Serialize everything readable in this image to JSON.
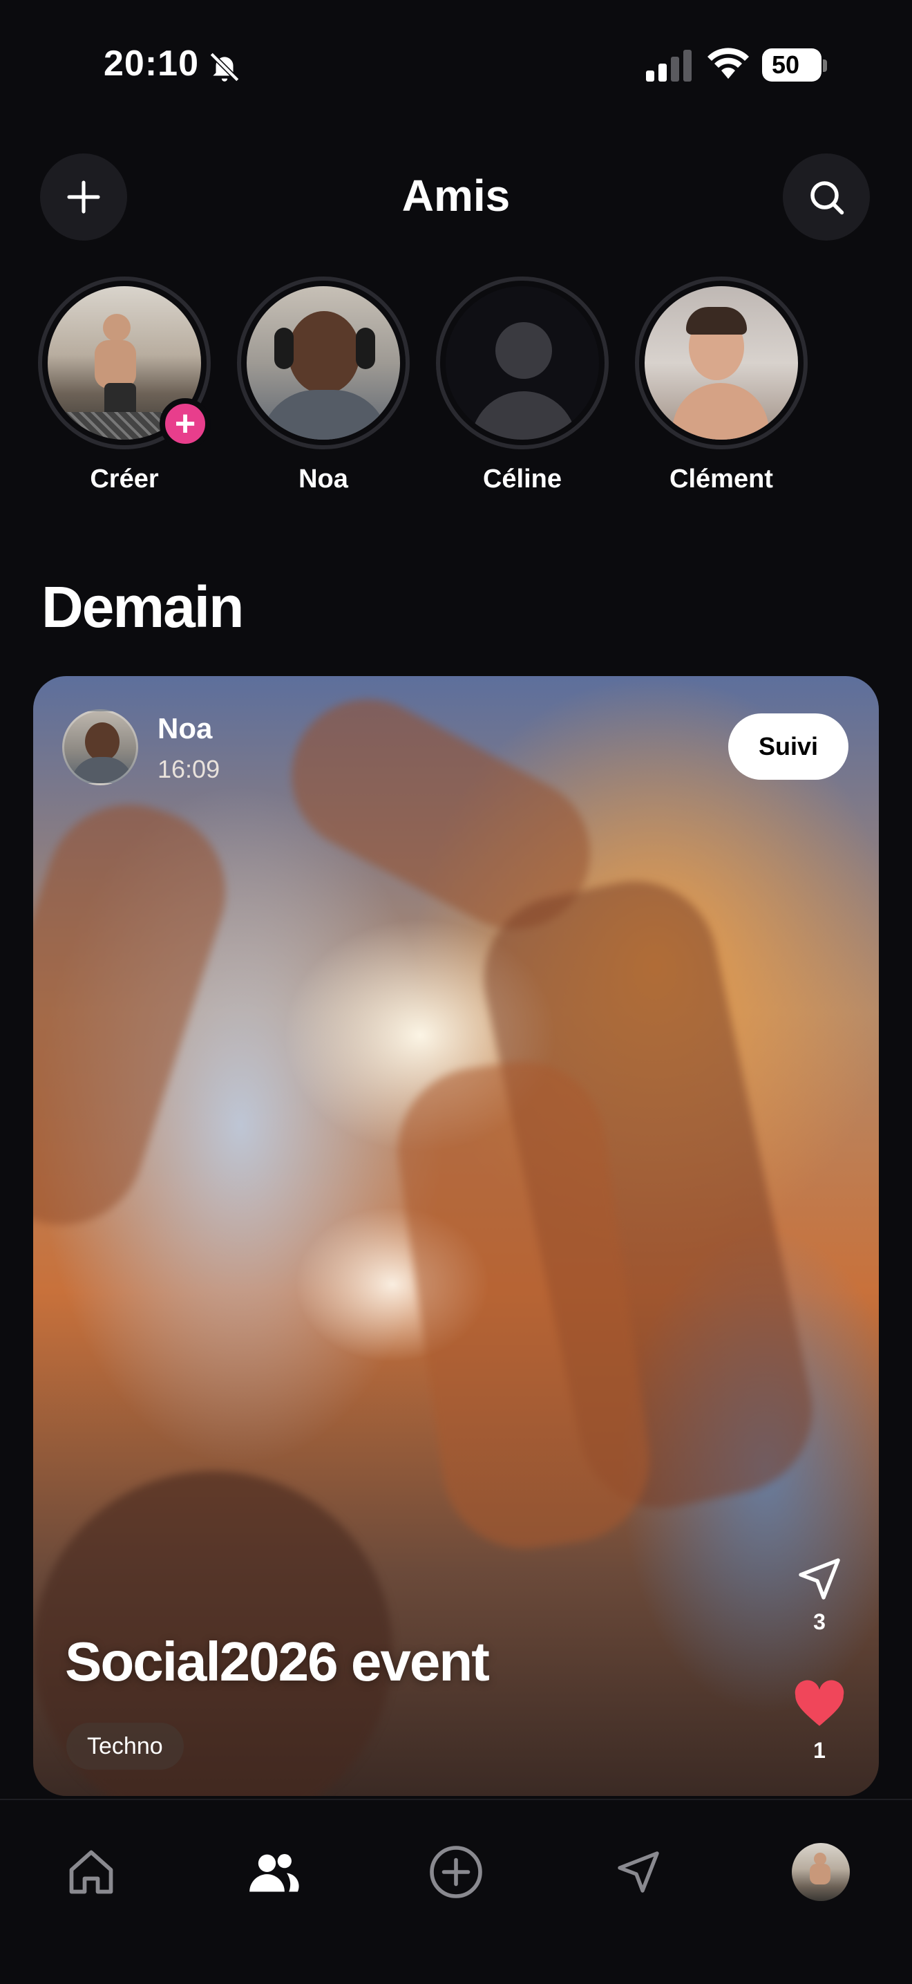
{
  "status_bar": {
    "time": "20:10",
    "battery": "50",
    "icons": [
      "bell-slash-icon",
      "cellular-signal-icon",
      "wifi-icon",
      "battery-icon"
    ]
  },
  "header": {
    "title": "Amis",
    "left_icon": "plus-icon",
    "right_icon": "search-icon"
  },
  "stories": [
    {
      "label": "Créer",
      "has_add_badge": true
    },
    {
      "label": "Noa"
    },
    {
      "label": "Céline",
      "placeholder": true
    },
    {
      "label": "Clément"
    }
  ],
  "section": {
    "title": "Demain"
  },
  "post": {
    "author": "Noa",
    "time": "16:09",
    "follow_label": "Suivi",
    "title": "Social2026 event",
    "tag": "Techno",
    "shares": "3",
    "likes": "1"
  },
  "bottom_nav": {
    "items": [
      "home-icon",
      "friends-icon",
      "create-icon",
      "send-icon",
      "profile-avatar"
    ],
    "active": "friends-icon"
  },
  "colors": {
    "background": "#0b0b0e",
    "accent_pink": "#e83e8c",
    "like_red": "#f0465a",
    "button_bg": "#1c1c21"
  }
}
